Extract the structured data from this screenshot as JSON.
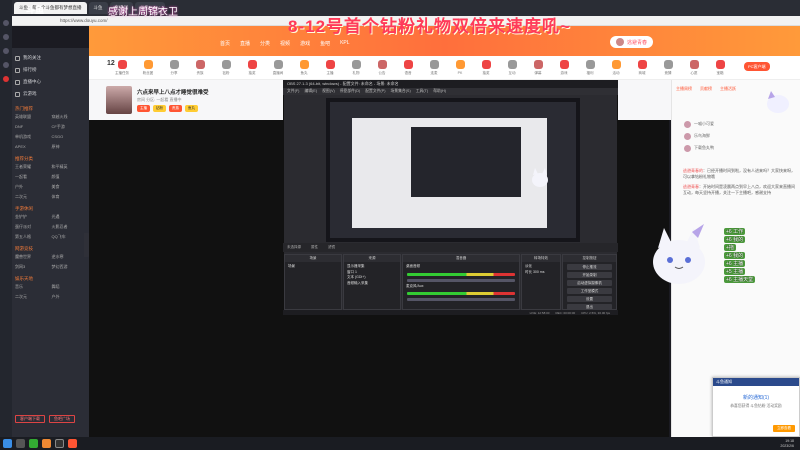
{
  "browser": {
    "tabs": [
      "斗鱼 - 每一个斗鱼都有梦想直播",
      "斗鱼",
      "直播间",
      "斗鱼Party"
    ],
    "address": "https://www.douyu.com/"
  },
  "header": {
    "logo": "斗鱼",
    "banner": "感谢上周锦衣卫",
    "announcement": "8-12号首个钻粉礼物双倍来速度吼~",
    "nav": [
      "首页",
      "直播",
      "分类",
      "视频",
      "游戏",
      "鱼吧",
      "KPL"
    ],
    "user_pill": "逃避青春"
  },
  "sidebar": {
    "items": [
      "我的关注",
      "排行榜",
      "直播中心",
      "云游戏"
    ],
    "sections": [
      {
        "title": "热门推荐",
        "cells": [
          "英雄联盟",
          "穿越火线",
          "DNF",
          "CF手游",
          "单机游戏",
          "CSGO",
          "APEX",
          "原神"
        ]
      },
      {
        "title": "推荐分类",
        "cells": [
          "王者荣耀",
          "和平精英",
          "一起看",
          "颜值",
          "户外",
          "美食",
          "二次元",
          "体育"
        ]
      },
      {
        "title": "手游休闲",
        "cells": [
          "金铲铲",
          "光遇",
          "蛋仔派对",
          "火影忍者",
          "第五人格",
          "QQ飞车"
        ]
      },
      {
        "title": "网游竞技",
        "cells": [
          "魔兽世界",
          "逆水寒",
          "剑网3",
          "梦幻西游"
        ]
      },
      {
        "title": "娱乐天地",
        "cells": [
          "音乐",
          "舞蹈",
          "二次元",
          "户外"
        ]
      }
    ],
    "buttons": [
      "客户端下载",
      "鱼吧广场"
    ]
  },
  "gifts": {
    "day": "12",
    "labels": [
      "主播任务",
      "粉丝团",
      "分享",
      "贵族",
      "钻粉",
      "抽奖",
      "直播间",
      "鱼丸",
      "主播",
      "礼物",
      "公告",
      "语音",
      "连麦",
      "PK",
      "抽奖",
      "互动",
      "弹幕",
      "游戏",
      "福利",
      "活动",
      "商城",
      "竞猜",
      "心愿",
      "宝箱",
      "道具",
      "周星",
      "守护",
      "视频",
      "表情"
    ],
    "pc_button": "PC客户端"
  },
  "room": {
    "title": "六点来早上八点才睡觉很难受",
    "subtitle": "房间  分区: 一起看  直播中",
    "badges": [
      "主播",
      "钻粉",
      "贵族",
      "鱼丸"
    ]
  },
  "obs": {
    "title": "OBS 27.1.3 (64-bit, windows) - 配置文件: 未命名 - 场景: 未命名",
    "menu": [
      "文件(F)",
      "编辑(E)",
      "视图(V)",
      "停靠部件(D)",
      "配置文件(P)",
      "场景集合(S)",
      "工具(T)",
      "帮助(H)"
    ],
    "bar": [
      "未选择源",
      "属性",
      "滤镜"
    ],
    "scenes": {
      "header": "场景",
      "items": [
        "场景"
      ]
    },
    "sources": {
      "header": "来源",
      "items": [
        "显示器采集",
        "窗口 1",
        "文本 (GDI+)",
        "音频输入采集"
      ]
    },
    "mixer": {
      "header": "混音器",
      "channels": [
        "桌面音频",
        "麦克风/Aux"
      ]
    },
    "transitions": {
      "header": "转场特效",
      "items": [
        "淡化",
        "时长 300 ms"
      ]
    },
    "controls": {
      "header": "控制按钮",
      "buttons": [
        "停止推流",
        "开始录制",
        "启动虚拟摄像机",
        "工作室模式",
        "设置",
        "退出"
      ]
    },
    "status": [
      "LIVE: 12:58:00",
      "REC: 00:00:00",
      "CPU: 2.5%, 30.00 fps"
    ]
  },
  "chat": {
    "tabs": [
      "主播周榜",
      "贡献榜",
      "主播活跃"
    ],
    "ranks": [
      "一喵小可爱",
      "乐鸟海鲜",
      "下载鱼丸鸭"
    ],
    "messages": [
      {
        "user": "逃避青春的",
        "text": "已经开播时间到啦，没有人进来吗？大家快来呀，可以拿钻粉礼物哦"
      },
      {
        "user": "逃避青春",
        "text": "开始时间是凌晨两点到早上八点，欢迎大家来直播间互动，每天坚持开播，关注一下主播吧，感谢支持"
      }
    ],
    "level_badges": [
      "+6 工作",
      "+6 我的",
      "+拖",
      "+6 我的",
      "+6 主播",
      "+5 主播",
      "+6 主播天堂"
    ]
  },
  "popup": {
    "title": "斗鱼通知",
    "heading": "新的通知(1)",
    "body": "恭喜您获得  斗鱼钻粉  活动奖励",
    "button": "立即查看"
  },
  "tray": {
    "time": "19:18",
    "date": "2023/2/6"
  },
  "colors": {
    "accent": "#ff6f3c",
    "announcement": "#ff3a5a",
    "obs_bg": "#2b2b30",
    "link_blue": "#2b6cd6"
  }
}
